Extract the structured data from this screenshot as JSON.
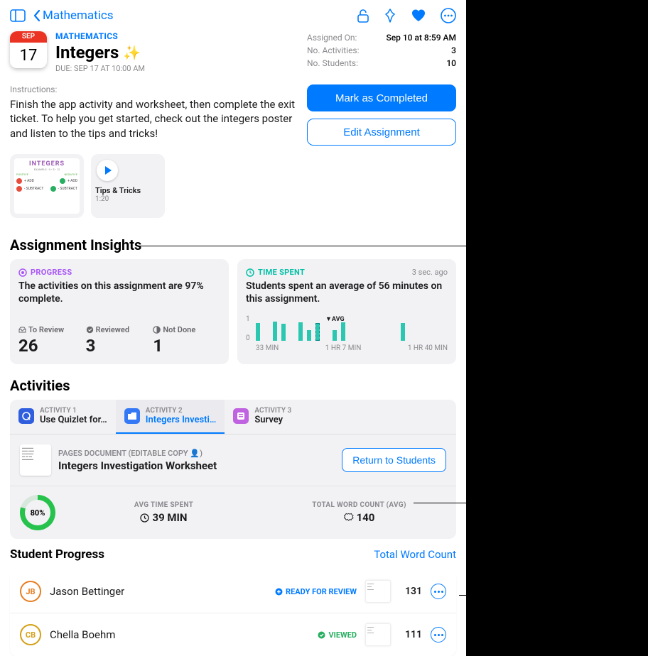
{
  "nav": {
    "back_label": "Mathematics"
  },
  "header": {
    "cal_month": "SEP",
    "cal_day": "17",
    "subject": "MATHEMATICS",
    "title": "Integers",
    "sparkle": "✨",
    "due": "DUE: SEP 17 AT 10:00 AM"
  },
  "meta": {
    "assigned_label": "Assigned On:",
    "assigned_val": "Sep 10 at 8:59 AM",
    "activities_label": "No. Activities:",
    "activities_val": "3",
    "students_label": "No. Students:",
    "students_val": "10"
  },
  "instructions": {
    "label": "Instructions:",
    "text": "Finish the app activity and worksheet, then complete the exit ticket. To help you get started, check out the integers poster and listen to the tips and tricks!"
  },
  "actions": {
    "primary": "Mark as Completed",
    "secondary": "Edit Assignment"
  },
  "attachments": {
    "poster_title": "INTEGERS",
    "tips_title": "Tips & Tricks",
    "tips_duration": "1:20"
  },
  "insights": {
    "section": "Assignment Insights",
    "progress_label": "PROGRESS",
    "progress_text": "The activities on this assignment are 97% complete.",
    "to_review_label": "To Review",
    "to_review_val": "26",
    "reviewed_label": "Reviewed",
    "reviewed_val": "3",
    "notdone_label": "Not Done",
    "notdone_val": "1",
    "time_label": "TIME SPENT",
    "time_stamp": "3 sec. ago",
    "time_text": "Students spent an average of 56 minutes on this assignment.",
    "avg_marker": "AVG",
    "y1": "1",
    "y0": "0",
    "x0": "33 MIN",
    "x1": "1 HR 7 MIN",
    "x2": "1 HR 40 MIN"
  },
  "activities": {
    "section": "Activities",
    "tab1_sub": "ACTIVITY 1",
    "tab1_title": "Use Quizlet for…",
    "tab2_sub": "ACTIVITY 2",
    "tab2_title": "Integers Investi…",
    "tab3_sub": "ACTIVITY 3",
    "tab3_title": "Survey",
    "doc_type": "PAGES DOCUMENT (EDITABLE COPY 👤)",
    "doc_name": "Integers Investigation Worksheet",
    "return_btn": "Return to Students",
    "ring_pct": "80%",
    "avg_time_label": "AVG TIME SPENT",
    "avg_time_val": "39 MIN",
    "word_label": "TOTAL WORD COUNT (AVG)",
    "word_val": "140"
  },
  "studentProgress": {
    "title": "Student Progress",
    "sort": "Total Word Count",
    "rows": [
      {
        "initials": "JB",
        "name": "Jason Bettinger",
        "status": "READY FOR REVIEW",
        "statusKind": "blue",
        "score": "131"
      },
      {
        "initials": "CB",
        "name": "Chella Boehm",
        "status": "VIEWED",
        "statusKind": "green",
        "score": "111"
      }
    ]
  }
}
